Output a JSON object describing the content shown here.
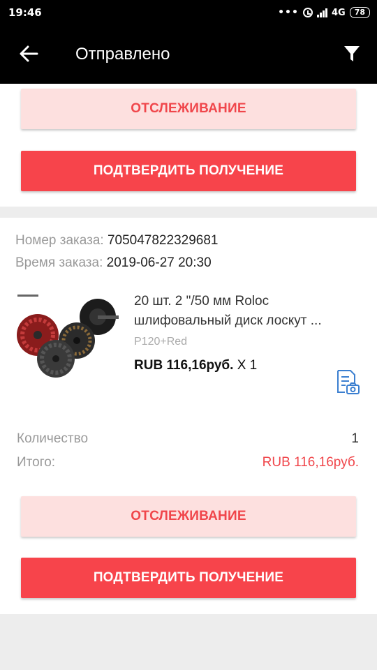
{
  "status_bar": {
    "time": "19:46",
    "network": "4G",
    "battery": "78"
  },
  "header": {
    "title": "Отправлено"
  },
  "top_card": {
    "track_label": "ОТСЛЕЖИВАНИЕ",
    "confirm_label": "ПОДТВЕРДИТЬ ПОЛУЧЕНИЕ"
  },
  "order": {
    "number_label": "Номер заказа:",
    "number": "705047822329681",
    "time_label": "Время заказа:",
    "time": "2019-06-27 20:30",
    "product": {
      "title": "20 шт. 2 \"/50 мм Roloc шлифовальный диск лоскут ...",
      "sku": "P120+Red",
      "price": "RUB 116,16руб.",
      "qty_mark": "X 1"
    },
    "quantity_label": "Количество",
    "quantity": "1",
    "total_label": "Итого:",
    "total": "RUB 116,16руб.",
    "track_label": "ОТСЛЕЖИВАНИЕ",
    "confirm_label": "ПОДТВЕРДИТЬ ПОЛУЧЕНИЕ"
  },
  "colors": {
    "accent": "#f7444b",
    "accent_light": "#fde0df",
    "icon_blue": "#3b7fd0"
  }
}
